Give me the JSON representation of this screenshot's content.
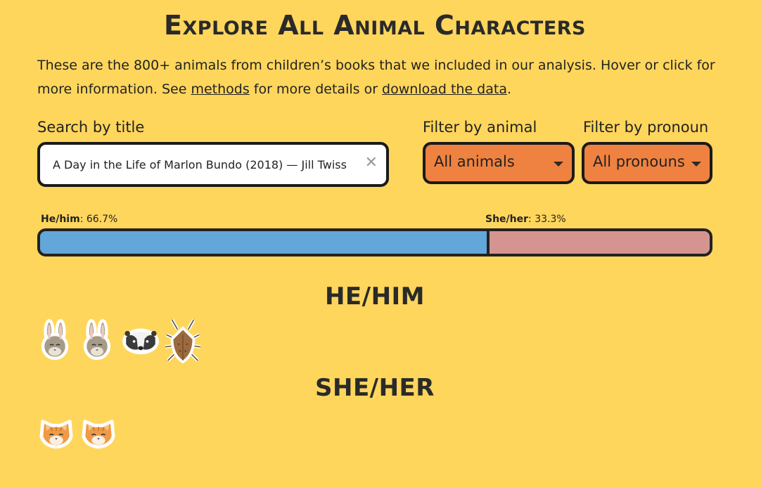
{
  "title": "Explore All Animal Characters",
  "intro": {
    "text1": "These are the 800+ animals from children’s books that we included in our analysis. Hover or click for more information. See ",
    "methods_link": "methods",
    "text2": " for more details or ",
    "download_link": "download the data",
    "text3": "."
  },
  "search": {
    "label": "Search by title",
    "value": "A Day in the Life of Marlon Bundo (2018) — Jill Twiss"
  },
  "filter_animal": {
    "label": "Filter by animal",
    "value": "All animals"
  },
  "filter_pronoun": {
    "label": "Filter by pronoun",
    "value": "All pronouns"
  },
  "pronoun_bar": {
    "he_label": "He/him",
    "he_pct_text": ": 66.7%",
    "he_fraction": 0.667,
    "she_label": "She/her",
    "she_pct_text": ": 33.3%",
    "she_fraction": 0.333
  },
  "sections": {
    "he": {
      "heading": "HE/HIM",
      "animals": [
        "rabbit-icon",
        "rabbit-icon",
        "badger-icon",
        "stinkbug-icon"
      ]
    },
    "she": {
      "heading": "SHE/HER",
      "animals": [
        "cat-icon",
        "cat-icon"
      ]
    }
  },
  "colors": {
    "background": "#FFD65C",
    "he": "#63A6D9",
    "she": "#D59490",
    "select": "#EF8240"
  }
}
